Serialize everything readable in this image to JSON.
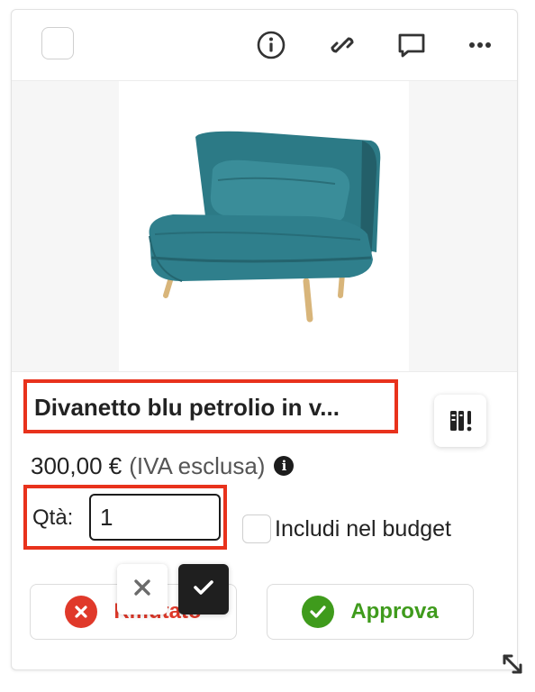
{
  "product": {
    "title": "Divanetto blu petrolio in v...",
    "price": "300,00 €",
    "vat_note": "(IVA esclusa)",
    "info_glyph": "i",
    "image_icon": "sofa-image"
  },
  "quantity": {
    "label": "Qtà:",
    "value": "1"
  },
  "budget": {
    "label": "Includi nel budget",
    "checked": false
  },
  "actions": {
    "reject_label": "Rifiutato",
    "approve_label": "Approva"
  },
  "toolbar_icons": [
    "info-icon",
    "link-icon",
    "comment-icon",
    "more-icon"
  ],
  "colors": {
    "highlight": "#e8321c",
    "reject": "#e0392a",
    "approve": "#3f9b1c",
    "sofa": "#2f7f8c",
    "dark": "#1f1f1f"
  }
}
